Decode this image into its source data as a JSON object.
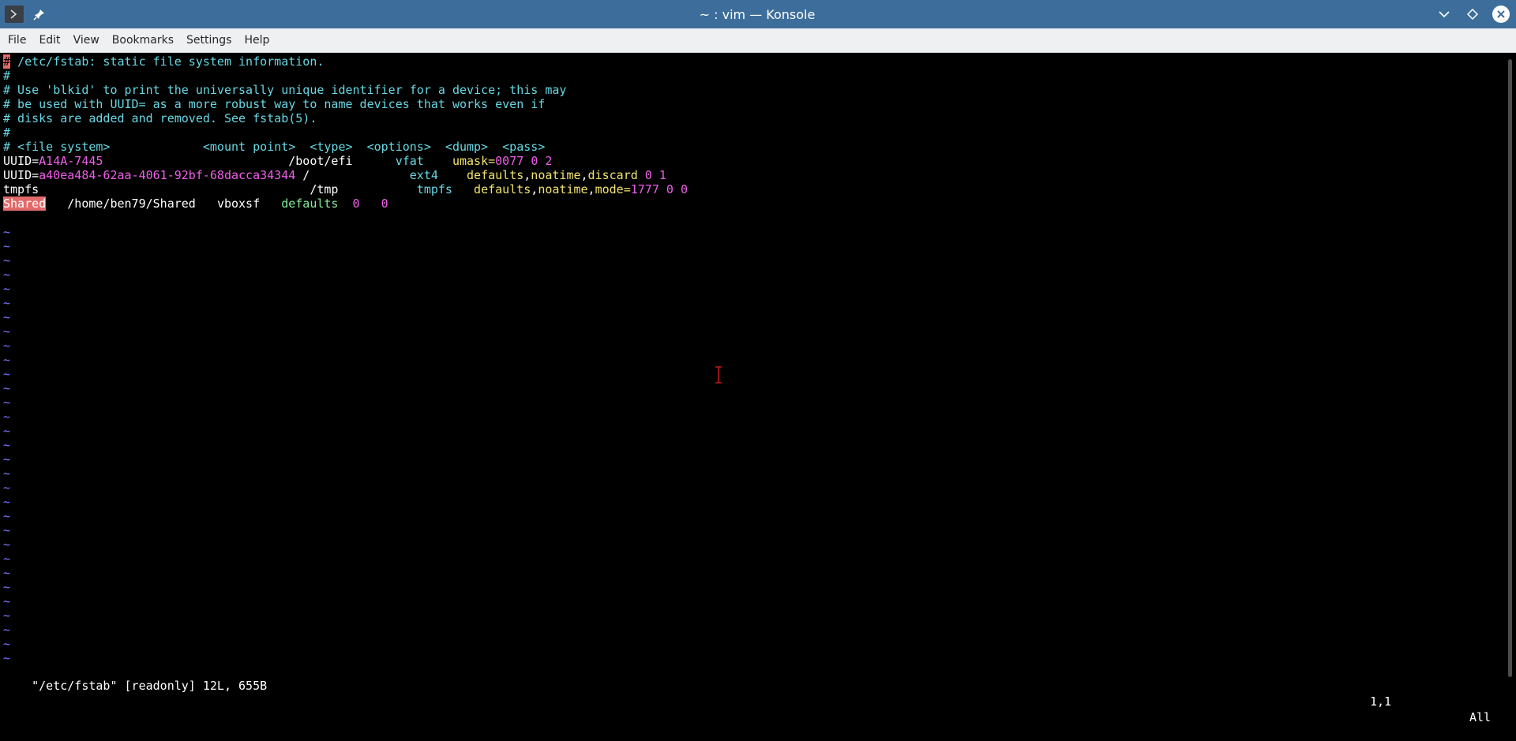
{
  "window": {
    "title": "~ : vim — Konsole",
    "app_icon": "terminal-icon",
    "controls": [
      "pin-icon",
      "minimize-icon",
      "maximize-icon",
      "close-icon"
    ]
  },
  "menubar": {
    "items": [
      "File",
      "Edit",
      "View",
      "Bookmarks",
      "Settings",
      "Help"
    ]
  },
  "editor": {
    "comments": [
      "/etc/fstab: static file system information.",
      "#",
      "# Use 'blkid' to print the universally unique identifier for a device; this may",
      "# be used with UUID= as a more robust way to name devices that works even if",
      "# disks are added and removed. See fstab(5).",
      "#",
      "# <file system>             <mount point>  <type>  <options>  <dump>  <pass>"
    ],
    "first_char": "#",
    "entries": [
      {
        "key": "UUID=",
        "id": "A14A-7445",
        "pad": "                          ",
        "mount": "/boot/efi",
        "mpad": "      ",
        "type": "vfat",
        "tpad": "    ",
        "options": [
          [
            "kw",
            "umask="
          ],
          [
            "num",
            "0077"
          ]
        ],
        "dump": "0",
        "pass": "2"
      },
      {
        "key": "UUID=",
        "id": "a40ea484-62aa-4061-92bf-68dacca34344",
        "pad": " ",
        "mount": "/",
        "mpad": "              ",
        "type": "ext4",
        "tpad": "    ",
        "options": [
          [
            "kw",
            "defaults"
          ],
          [
            "txt",
            ","
          ],
          [
            "kw",
            "noatime"
          ],
          [
            "txt",
            ","
          ],
          [
            "kw",
            "discard"
          ]
        ],
        "dump": "0",
        "pass": "1"
      },
      {
        "key": "tmpfs",
        "id": "",
        "pad": "                                      ",
        "mount": "/tmp",
        "mpad": "           ",
        "type": "tmpfs",
        "tpad": "   ",
        "options": [
          [
            "kw",
            "defaults"
          ],
          [
            "txt",
            ","
          ],
          [
            "kw",
            "noatime"
          ],
          [
            "txt",
            ","
          ],
          [
            "kw",
            "mode="
          ],
          [
            "num",
            "1777"
          ]
        ],
        "dump": "0",
        "pass": "0"
      }
    ],
    "shared_line": {
      "name": "Shared",
      "mount": "/home/ben79/Shared",
      "type": "vboxsf",
      "options": "defaults",
      "dump": "0",
      "pass": "0"
    },
    "empty_line_marker": "~",
    "empty_line_count": 31
  },
  "status": {
    "message": "\"/etc/fstab\" [readonly] 12L, 655B",
    "position": "1,1",
    "scroll": "All"
  },
  "colors": {
    "titlebar": "#3d6e9b",
    "comment": "#67d7e3",
    "identifier": "#ee5fe9",
    "keyword": "#f3e46b",
    "search_highlight": "#e26a6a",
    "tilde": "#7a78ff"
  }
}
